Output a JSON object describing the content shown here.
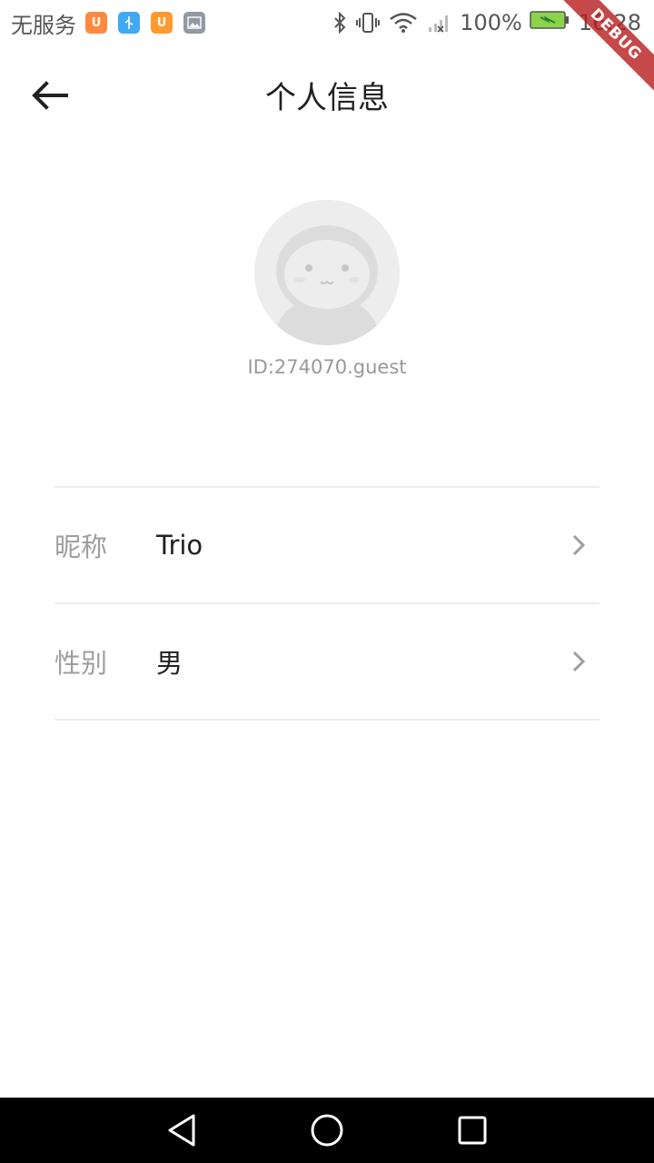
{
  "status_bar": {
    "carrier": "无服务",
    "battery": "100%",
    "time": "16:28",
    "icons": [
      "bluetooth-icon",
      "vibrate-icon",
      "wifi-icon",
      "signal-icon",
      "battery-icon"
    ],
    "app_icons": [
      {
        "name": "uc-browser-icon",
        "color": "#ff8a3d"
      },
      {
        "name": "usb-icon",
        "color": "#3fa9f5"
      },
      {
        "name": "uc-browser-icon",
        "color": "#ff9a2e"
      },
      {
        "name": "gallery-icon",
        "color": "#8f9aa3"
      }
    ]
  },
  "debug_banner": "DEBUG",
  "header": {
    "title": "个人信息",
    "back_icon": "arrow-left-icon"
  },
  "profile": {
    "user_id": "ID:274070.guest",
    "avatar_icon": "default-avatar-icon"
  },
  "rows": [
    {
      "label": "昵称",
      "value": "Trio"
    },
    {
      "label": "性别",
      "value": "男"
    }
  ],
  "nav": [
    "back-triangle-icon",
    "home-circle-icon",
    "recents-square-icon"
  ],
  "colors": {
    "background": "#ffffff",
    "title_text": "#212121",
    "label_text": "#9e9e9e",
    "id_text": "#999999",
    "divider": "#eeeeee",
    "chevron": "#9e9e9e",
    "debug_ribbon": "#b71c1c",
    "nav_bar": "#000000"
  }
}
